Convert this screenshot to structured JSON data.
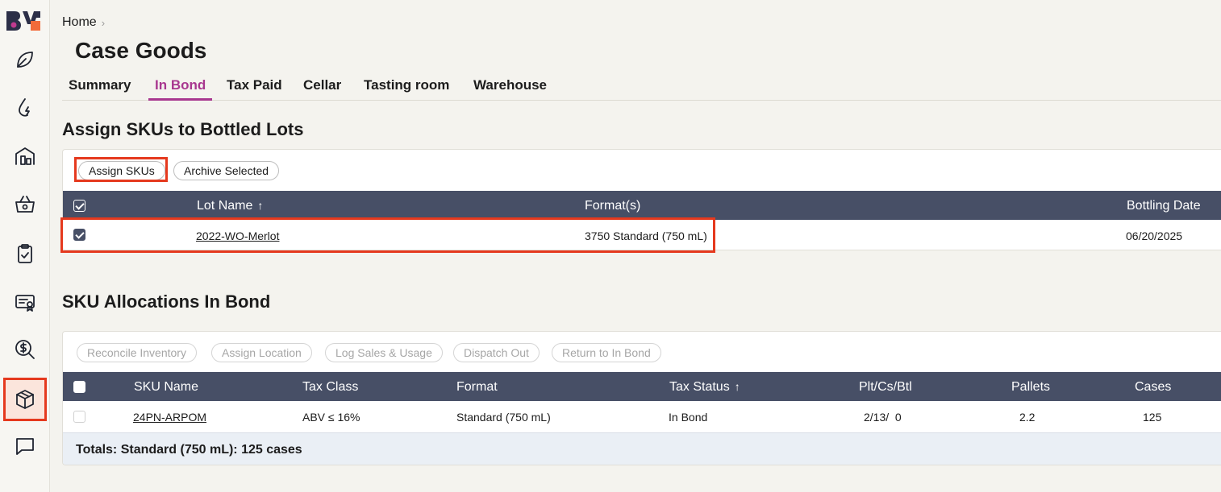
{
  "colors": {
    "accent": "#a8378f",
    "highlight": "#e5391e",
    "table_header": "#474f66",
    "logo_orange": "#f26b3a",
    "logo_dark": "#2c2f48"
  },
  "sidebar": {
    "logo": "BV",
    "items": [
      {
        "icon": "leaf-icon"
      },
      {
        "icon": "water-drop-icon"
      },
      {
        "icon": "building-icon"
      },
      {
        "icon": "basket-icon"
      },
      {
        "icon": "clipboard-check-icon"
      },
      {
        "icon": "certificate-icon"
      },
      {
        "icon": "dollar-search-icon"
      },
      {
        "icon": "box-icon",
        "active": true
      },
      {
        "icon": "chat-icon"
      }
    ]
  },
  "breadcrumb": {
    "home": "Home"
  },
  "page": {
    "title": "Case Goods"
  },
  "tabs": [
    {
      "label": "Summary"
    },
    {
      "label": "In Bond",
      "active": true
    },
    {
      "label": "Tax Paid"
    },
    {
      "label": "Cellar"
    },
    {
      "label": "Tasting room"
    },
    {
      "label": "Warehouse"
    }
  ],
  "assign": {
    "title": "Assign SKUs to Bottled Lots",
    "buttons": {
      "assign": "Assign SKUs",
      "archive": "Archive Selected"
    },
    "columns": {
      "lot_name": "Lot Name",
      "formats": "Format(s)",
      "bottling_date": "Bottling Date"
    },
    "sort_arrow": "↑",
    "rows": [
      {
        "lot_name": "2022-WO-Merlot",
        "formats": "3750 Standard (750 mL)",
        "bottling_date": "06/20/2025",
        "checked": true
      }
    ]
  },
  "allocations": {
    "title": "SKU Allocations In Bond",
    "buttons": {
      "reconcile": "Reconcile Inventory",
      "location": "Assign Location",
      "log_sales": "Log Sales & Usage",
      "dispatch": "Dispatch Out",
      "return": "Return to In Bond"
    },
    "columns": {
      "sku_name": "SKU Name",
      "tax_class": "Tax Class",
      "format": "Format",
      "tax_status": "Tax Status",
      "plt_cs_btl": "Plt/Cs/Btl",
      "pallets": "Pallets",
      "cases": "Cases"
    },
    "sort_arrow": "↑",
    "rows": [
      {
        "sku_name": "24PN-ARPOM",
        "tax_class": "ABV ≤ 16%",
        "format": "Standard (750 mL)",
        "tax_status": "In Bond",
        "plt_cs_btl": "2/13/  0",
        "pallets": "2.2",
        "cases": "125"
      }
    ],
    "totals": "Totals: Standard (750 mL): 125 cases"
  }
}
